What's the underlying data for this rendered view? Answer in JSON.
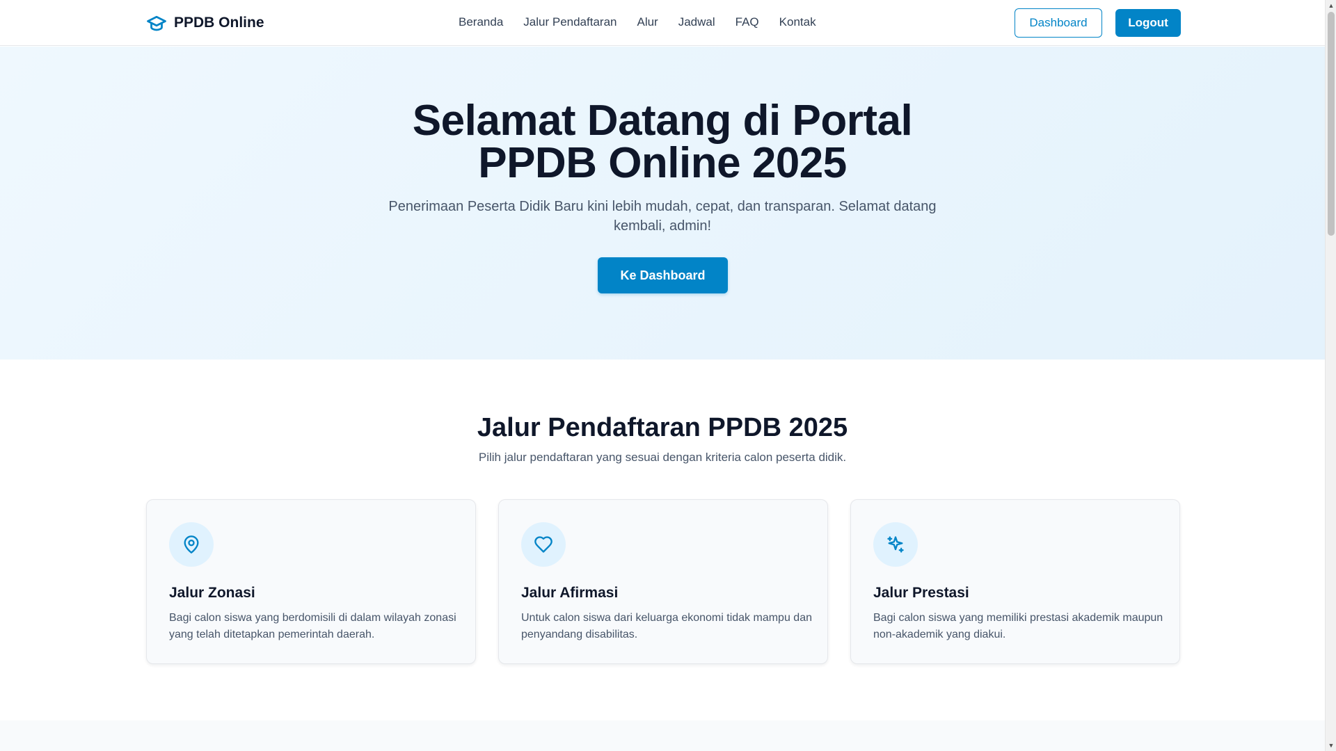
{
  "navbar": {
    "brand": "PPDB Online",
    "links": [
      "Beranda",
      "Jalur Pendaftaran",
      "Alur",
      "Jadwal",
      "FAQ",
      "Kontak"
    ],
    "dashboard_label": "Dashboard",
    "logout_label": "Logout"
  },
  "hero": {
    "title_line1": "Selamat Datang di Portal",
    "title_line2": "PPDB Online 2025",
    "subtitle": "Penerimaan Peserta Didik Baru kini lebih mudah, cepat, dan transparan. Selamat datang kembali, admin!",
    "cta_label": "Ke Dashboard"
  },
  "section": {
    "title": "Jalur Pendaftaran PPDB 2025",
    "subtitle": "Pilih jalur pendaftaran yang sesuai dengan kriteria calon peserta didik.",
    "cards": [
      {
        "icon": "map-pin-icon",
        "title": "Jalur Zonasi",
        "desc": "Bagi calon siswa yang berdomisili di dalam wilayah zonasi yang telah ditetapkan pemerintah daerah."
      },
      {
        "icon": "heart-icon",
        "title": "Jalur Afirmasi",
        "desc": "Untuk calon siswa dari keluarga ekonomi tidak mampu dan penyandang disabilitas."
      },
      {
        "icon": "sparkles-icon",
        "title": "Jalur Prestasi",
        "desc": "Bagi calon siswa yang memiliki prestasi akademik maupun non-akademik yang diakui."
      }
    ]
  },
  "colors": {
    "primary": "#0284c7",
    "hero_bg": "#eff8fe",
    "text_dark": "#0f172a",
    "text_muted": "#475569",
    "icon_bg": "#e0f2fe"
  }
}
